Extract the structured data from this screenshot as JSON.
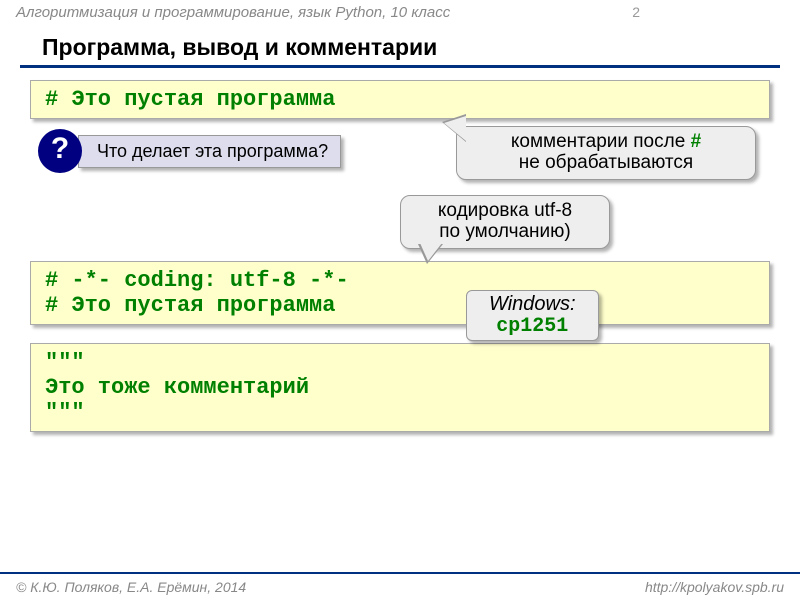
{
  "header": {
    "course": "Алгоритмизация и программирование, язык Python, 10 класс",
    "page": "2"
  },
  "title": "Программа, вывод и комментарии",
  "code1": {
    "line1": "# Это пустая программа"
  },
  "question": {
    "mark": "?",
    "text": "Что делает эта программа?"
  },
  "callout1": {
    "before": "комментарии после ",
    "hash": "#",
    "after": " не обрабатываются"
  },
  "callout2": {
    "line1": "кодировка utf-8",
    "line2": "по умолчанию)"
  },
  "code2": {
    "line1": "# -*- coding: utf-8 -*-",
    "line2": "# Это пустая программа"
  },
  "windows": {
    "label": "Windows:",
    "value": "cp1251"
  },
  "code3": {
    "line1": "\"\"\"",
    "line2": "Это тоже комментарий",
    "line3": "\"\"\""
  },
  "footer": {
    "left": "© К.Ю. Поляков, Е.А. Ерёмин, 2014",
    "right": "http://kpolyakov.spb.ru"
  }
}
